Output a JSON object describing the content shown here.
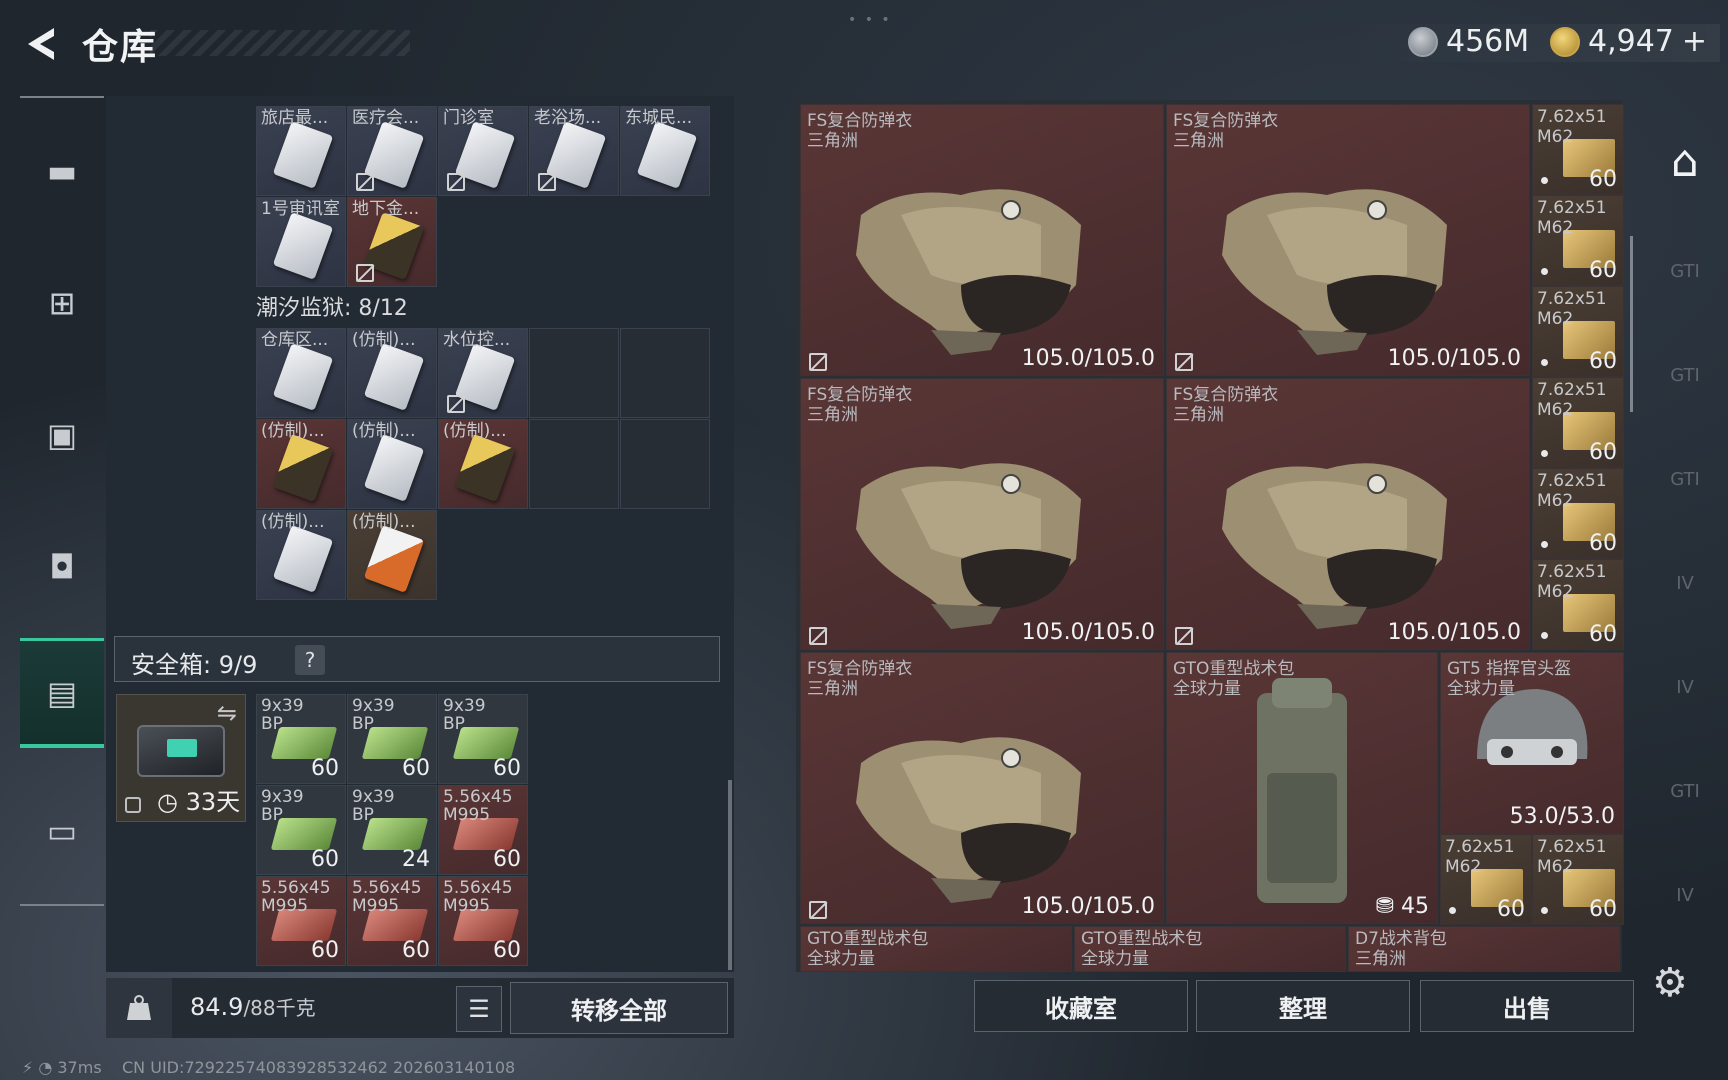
{
  "header": {
    "title": "仓库",
    "currency_silver": "456M",
    "currency_gold": "4,947",
    "currency_plus": "+"
  },
  "nav": {
    "items": [
      "gun-icon",
      "vest-icon",
      "backpack-icon",
      "bag-icon",
      "safebox-icon",
      "briefcase-icon"
    ],
    "active_index": 4
  },
  "keys_top": [
    {
      "label": "旅店最...",
      "style": "blue",
      "card": "white",
      "unbind": false
    },
    {
      "label": "医疗会...",
      "style": "blue",
      "card": "white",
      "unbind": true
    },
    {
      "label": "门诊室",
      "style": "blue",
      "card": "white",
      "unbind": true
    },
    {
      "label": "老浴场...",
      "style": "blue",
      "card": "white",
      "unbind": true
    },
    {
      "label": "东城民...",
      "style": "blue",
      "card": "white",
      "unbind": false
    },
    {
      "label": "1号审讯室",
      "style": "blue",
      "card": "white",
      "unbind": false
    },
    {
      "label": "地下金...",
      "style": "red",
      "card": "gold",
      "unbind": true
    }
  ],
  "section_label": "潮汐监狱: 8/12",
  "keys_prison": [
    {
      "label": "仓库区...",
      "style": "blue",
      "card": "white",
      "unbind": false
    },
    {
      "label": "(仿制)...",
      "style": "blue",
      "card": "white",
      "unbind": false
    },
    {
      "label": "水位控...",
      "style": "blue",
      "card": "white",
      "unbind": true
    },
    {
      "label": "(仿制)...",
      "style": "red",
      "card": "gold",
      "unbind": false
    },
    {
      "label": "(仿制)...",
      "style": "blue",
      "card": "white",
      "unbind": false
    },
    {
      "label": "(仿制)...",
      "style": "red",
      "card": "gold",
      "unbind": false
    },
    {
      "label": "(仿制)...",
      "style": "blue",
      "card": "white",
      "unbind": false
    },
    {
      "label": "(仿制)...",
      "style": "brown",
      "card": "orange",
      "unbind": false
    }
  ],
  "safe": {
    "label": "安全箱: 9/9",
    "help": "?",
    "days": "33天",
    "swap": "⇋"
  },
  "safe_items": [
    {
      "l1": "9x39",
      "l2": "BP",
      "qty": "60",
      "color": "green"
    },
    {
      "l1": "9x39",
      "l2": "BP",
      "qty": "60",
      "color": "green"
    },
    {
      "l1": "9x39",
      "l2": "BP",
      "qty": "60",
      "color": "green"
    },
    {
      "l1": "9x39",
      "l2": "BP",
      "qty": "60",
      "color": "green"
    },
    {
      "l1": "9x39",
      "l2": "BP",
      "qty": "24",
      "color": "green"
    },
    {
      "l1": "5.56x45",
      "l2": "M995",
      "qty": "60",
      "color": "red"
    },
    {
      "l1": "5.56x45",
      "l2": "M995",
      "qty": "60",
      "color": "red"
    },
    {
      "l1": "5.56x45",
      "l2": "M995",
      "qty": "60",
      "color": "red"
    },
    {
      "l1": "5.56x45",
      "l2": "M995",
      "qty": "60",
      "color": "red"
    }
  ],
  "bottom_left": {
    "weight": "84.9",
    "weight_cap": "/88千克",
    "transfer": "转移全部",
    "list_icon": "☰"
  },
  "status": {
    "ping": "37ms",
    "uid": "CN UID:7292257408392853246​2 202603140108"
  },
  "armor": [
    {
      "name": "FS复合防弹衣",
      "sub": "三角洲",
      "dur": "105.0/105.0"
    },
    {
      "name": "FS复合防弹衣",
      "sub": "三角洲",
      "dur": "105.0/105.0"
    },
    {
      "name": "FS复合防弹衣",
      "sub": "三角洲",
      "dur": "105.0/105.0"
    },
    {
      "name": "FS复合防弹衣",
      "sub": "三角洲",
      "dur": "105.0/105.0"
    },
    {
      "name": "FS复合防弹衣",
      "sub": "三角洲",
      "dur": "105.0/105.0"
    }
  ],
  "ammo_right": {
    "l1": "7.62x51",
    "l2": "M62",
    "qty": "60"
  },
  "backpack": {
    "name": "GTO重型战术包",
    "sub": "全球力量",
    "count": "45"
  },
  "helmet": {
    "name": "GT5 指挥官头盔",
    "sub": "全球力量",
    "dur": "53.0/53.0"
  },
  "bottom_row": [
    {
      "name": "GTO重型战术包",
      "sub": "全球力量"
    },
    {
      "name": "GTO重型战术包",
      "sub": "全球力量"
    },
    {
      "name": "D7战术背包",
      "sub": "三角洲"
    }
  ],
  "right_buttons": {
    "collect": "收藏室",
    "sort": "整理",
    "sell": "出售"
  },
  "rail": [
    "GTI",
    "GTI",
    "GTI",
    "IV",
    "IV",
    "GTI",
    "IV"
  ]
}
